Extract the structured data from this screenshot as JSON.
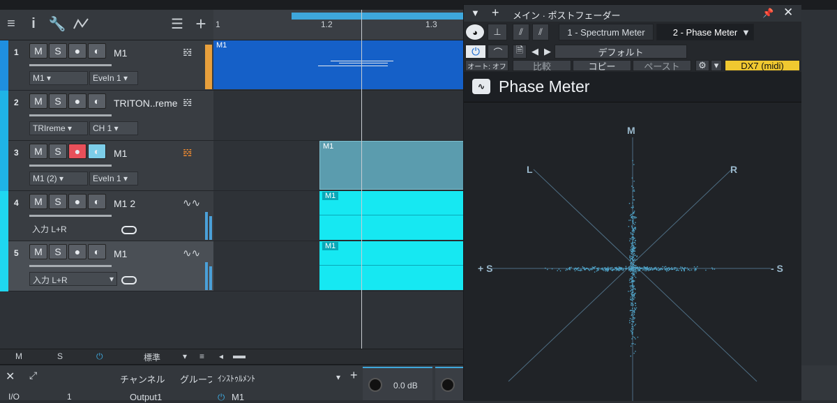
{
  "toolbar": {
    "icons": [
      "menu-icon",
      "info-icon",
      "wrench-icon",
      "automation-icon",
      "list-icon",
      "add-icon"
    ]
  },
  "ruler": {
    "marks": [
      "1",
      "1.2",
      "1.3"
    ]
  },
  "tracks": [
    {
      "num": "1",
      "m": "M",
      "s": "S",
      "name": "M1",
      "drop1": "M1",
      "drop2": "EveIn 1",
      "type": "instrument",
      "color": "#1f8fe0"
    },
    {
      "num": "2",
      "m": "M",
      "s": "S",
      "name": "TRITON..reme",
      "drop1": "TRIreme",
      "drop2": "CH 1",
      "type": "instrument",
      "color": "#1fb3e6"
    },
    {
      "num": "3",
      "m": "M",
      "s": "S",
      "name": "M1",
      "drop1": "M1 (2)",
      "drop2": "EveIn 1",
      "type": "instrument",
      "color": "#1fb3e6"
    },
    {
      "num": "4",
      "m": "M",
      "s": "S",
      "name": "M1 2",
      "drop1": "入力 L+R",
      "drop2": "",
      "type": "audio",
      "color": "#1fd7f0"
    },
    {
      "num": "5",
      "m": "M",
      "s": "S",
      "name": "M1",
      "drop1": "入力 L+R",
      "drop2": "",
      "type": "audio",
      "color": "#1fd7f0"
    }
  ],
  "clips": [
    {
      "label": "M1",
      "color": "#1560c8"
    },
    {
      "label": "M1",
      "color": "#5b9cae"
    },
    {
      "label": "M1",
      "color": "#16e8f2"
    },
    {
      "label": "M1",
      "color": "#16e8f2"
    }
  ],
  "bottombar": {
    "m": "M",
    "s": "S",
    "power": "⏻",
    "mode": "標準"
  },
  "mixer": {
    "channel": "チャンネル",
    "group": "グループ",
    "instrument": "ｲﾝｽﾄｩﾙﾒﾝﾄ",
    "volume": "0.0 dB",
    "io": "I/O",
    "ch_num": "1",
    "output": "Output1",
    "inst_name": "M1"
  },
  "plugin": {
    "title": "メイン · ポストフェーダー",
    "tab1": "1 - Spectrum Meter",
    "tab2": "2 - Phase Meter",
    "preset": "デフォルト",
    "auto": "オート: オフ",
    "compare": "比較",
    "copy": "コピー",
    "paste": "ペースト",
    "device": "DX7 (midi)",
    "header": "Phase Meter",
    "labels": {
      "m": "M",
      "l": "L",
      "r": "R",
      "sp": "+ S",
      "sm": "- S"
    }
  },
  "colors": {
    "accent": "#3ea7dc",
    "record": "#e8505a",
    "device": "#f0c830",
    "scope": "#4ea3c8"
  }
}
